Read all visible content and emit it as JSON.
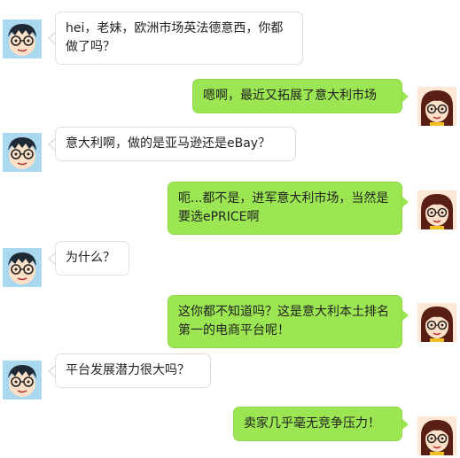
{
  "conversation": {
    "messages": [
      {
        "sender": "male",
        "text": "hei，老妹，欧洲市场英法德意西，你都做了吗？"
      },
      {
        "sender": "female",
        "text": "嗯啊，最近又拓展了意大利市场"
      },
      {
        "sender": "male",
        "text": "意大利啊，做的是亚马逊还是eBay？"
      },
      {
        "sender": "female",
        "text": "呃...都不是，进军意大利市场，当然是要选ePRICE啊"
      },
      {
        "sender": "male",
        "text": "为什么？"
      },
      {
        "sender": "female",
        "text": "这你都不知道吗？这是意大利本土排名第一的电商平台呢！"
      },
      {
        "sender": "male",
        "text": "平台发展潜力很大吗？"
      },
      {
        "sender": "female",
        "text": "卖家几乎毫无竞争压力！"
      }
    ]
  },
  "colors": {
    "incoming_bubble": "#ffffff",
    "outgoing_bubble": "#9be652",
    "bubble_border": "#dedede"
  },
  "icons": {
    "male": "boy-avatar-icon",
    "female": "girl-avatar-icon"
  }
}
